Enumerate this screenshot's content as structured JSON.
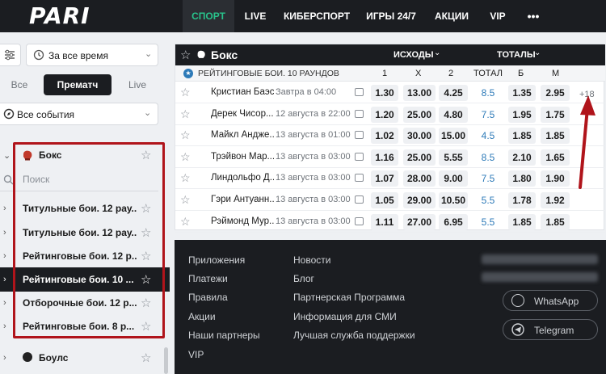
{
  "brand": {
    "logo_text": "PARI"
  },
  "topnav": {
    "items": [
      "СПОРТ",
      "LIVE",
      "КИБЕРСПОРТ",
      "ИГРЫ 24/7",
      "АКЦИИ",
      "VIP"
    ],
    "more": "•••"
  },
  "sidebar": {
    "period_select": "За все время",
    "segments": [
      "Все",
      "Прематч",
      "Live"
    ],
    "events_select": "Все события",
    "sport": "Бокс",
    "search_placeholder": "Поиск",
    "items": [
      {
        "label": "Титульные бои. 12 рау..."
      },
      {
        "label": "Титульные бои. 12 рау..."
      },
      {
        "label": "Рейтинговые бои. 12 р..."
      },
      {
        "label": "Рейтинговые бои. 10 ..."
      },
      {
        "label": "Отборочные бои. 12 р..."
      },
      {
        "label": "Рейтинговые бои. 8 р..."
      }
    ],
    "next_sport": "Боулс"
  },
  "events": {
    "sport_title": "Бокс",
    "outcomes_label": "ИСХОДЫ",
    "totals_label": "ТОТАЛЫ",
    "league": "РЕЙТИНГОВЫЕ БОИ. 10 РАУНДОВ",
    "col_headers": [
      "1",
      "X",
      "2",
      "ТОТАЛ",
      "Б",
      "М"
    ],
    "more_markets": "+18",
    "rows": [
      {
        "name": "Кристиан Баэс ...",
        "time": "Завтра в 04:00",
        "o1": "1.30",
        "ox": "13.00",
        "o2": "4.25",
        "total": "8.5",
        "over": "1.35",
        "under": "2.95"
      },
      {
        "name": "Дерек Чисор...",
        "time": "12 августа в 22:00",
        "o1": "1.20",
        "ox": "25.00",
        "o2": "4.80",
        "total": "7.5",
        "over": "1.95",
        "under": "1.75"
      },
      {
        "name": "Майкл Андже...",
        "time": "13 августа в 01:00",
        "o1": "1.02",
        "ox": "30.00",
        "o2": "15.00",
        "total": "4.5",
        "over": "1.85",
        "under": "1.85"
      },
      {
        "name": "Трэйвон Мар...",
        "time": "13 августа в 03:00",
        "o1": "1.16",
        "ox": "25.00",
        "o2": "5.55",
        "total": "8.5",
        "over": "2.10",
        "under": "1.65"
      },
      {
        "name": "Линдольфо Д...",
        "time": "13 августа в 03:00",
        "o1": "1.07",
        "ox": "28.00",
        "o2": "9.00",
        "total": "7.5",
        "over": "1.80",
        "under": "1.90"
      },
      {
        "name": "Гэри Антуанн...",
        "time": "13 августа в 03:00",
        "o1": "1.05",
        "ox": "29.00",
        "o2": "10.50",
        "total": "5.5",
        "over": "1.78",
        "under": "1.92"
      },
      {
        "name": "Рэймонд Мур...",
        "time": "13 августа в 03:00",
        "o1": "1.11",
        "ox": "27.00",
        "o2": "6.95",
        "total": "5.5",
        "over": "1.85",
        "under": "1.85"
      }
    ]
  },
  "footer": {
    "col1": [
      "Приложения",
      "Платежи",
      "Правила",
      "Акции",
      "Наши партнеры",
      "VIP"
    ],
    "col2": [
      "Новости",
      "Блог",
      "Партнерская Программа",
      "Информация для СМИ",
      "Лучшая служба поддержки"
    ],
    "whatsapp": "WhatsApp",
    "telegram": "Telegram"
  },
  "colors": {
    "accent_green": "#28c28b",
    "annotation_red": "#b0141b",
    "dark_bg": "#1b1d21"
  }
}
